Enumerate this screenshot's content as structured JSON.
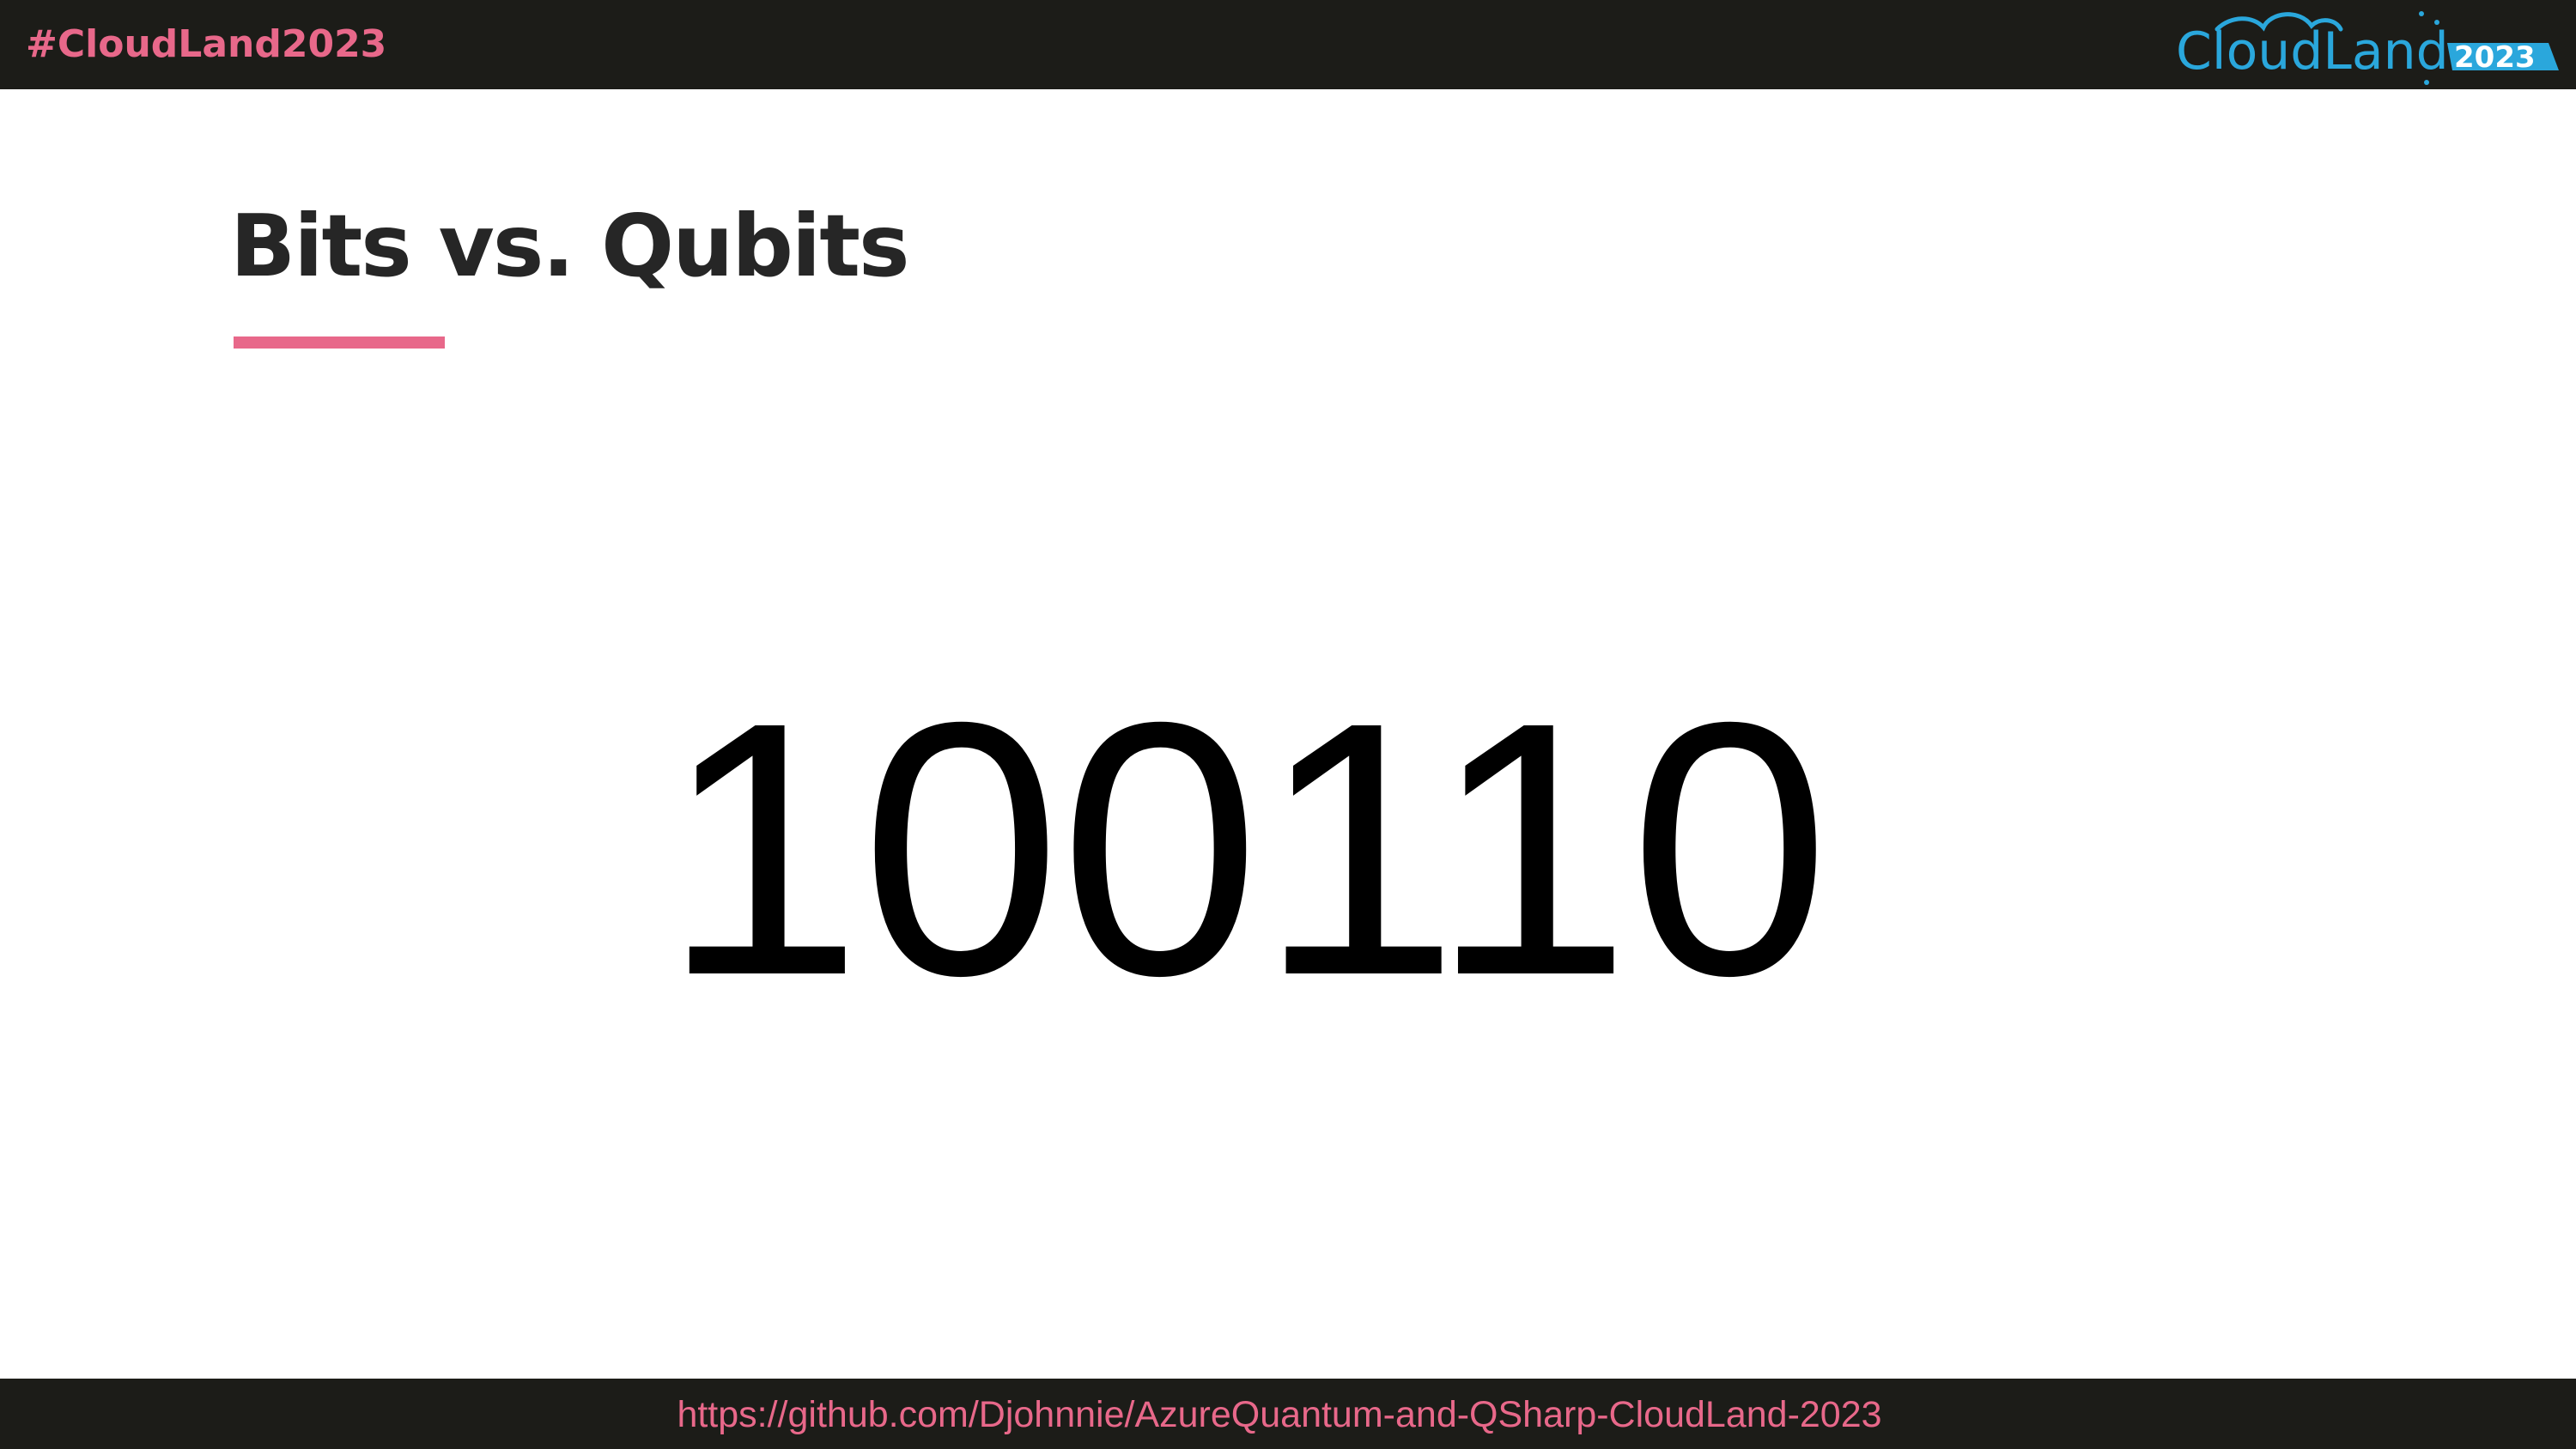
{
  "header": {
    "hashtag": "#CloudLand2023",
    "logo": {
      "text": "CloudLand",
      "year": "2023",
      "text_color": "#2aa7dc",
      "year_bg_color": "#2aa7dc",
      "year_text_color": "#ffffff"
    }
  },
  "slide": {
    "title": "Bits vs. Qubits",
    "main_value": "100110"
  },
  "footer": {
    "link": "https://github.com/Djohnnie/AzureQuantum-and-QSharp-CloudLand-2023"
  },
  "colors": {
    "bar_background": "#1c1c18",
    "accent": "#e8688a",
    "title": "#262626",
    "body_text": "#000000"
  }
}
